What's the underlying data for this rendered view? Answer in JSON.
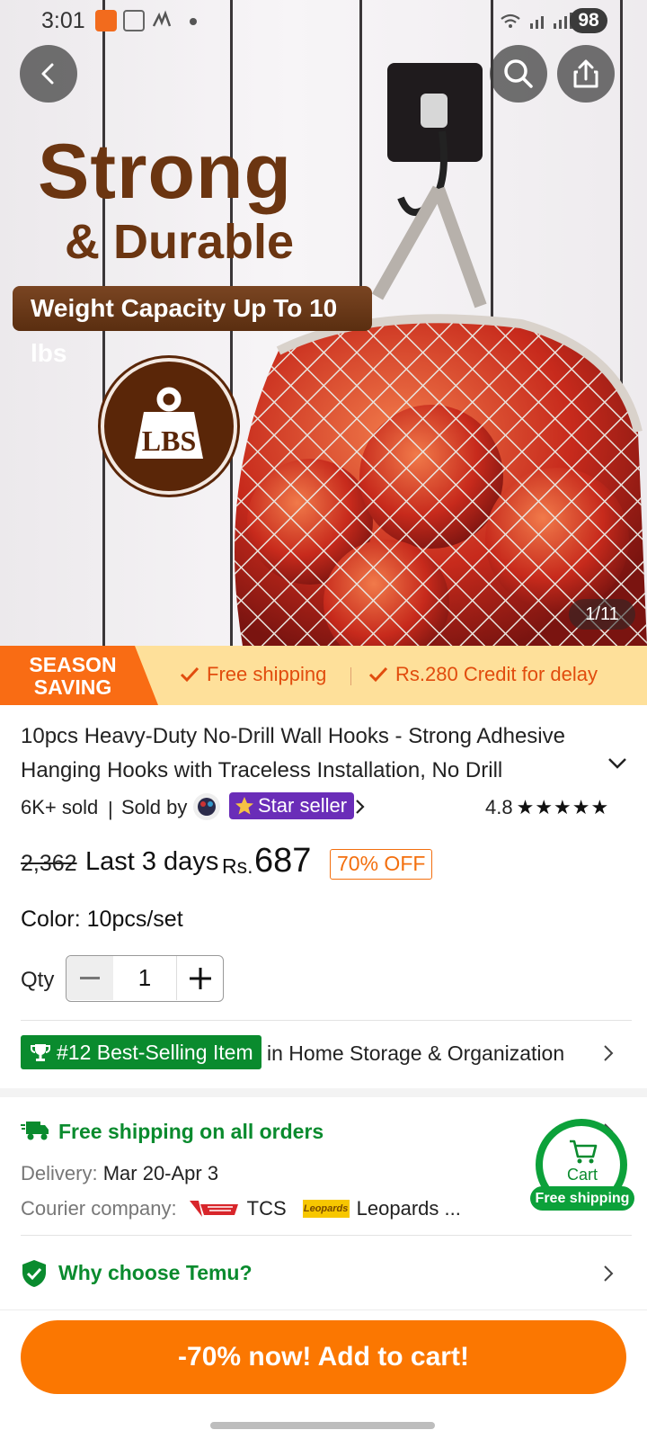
{
  "status_bar": {
    "time": "3:01",
    "battery": "98"
  },
  "hero": {
    "headline": "Strong",
    "subheadline": "& Durable",
    "ribbon": "Weight Capacity Up To 10 lbs",
    "badge": "LBS",
    "photo_counter": "1/11"
  },
  "promo": {
    "season_line1": "SEASON",
    "season_line2": "SAVING",
    "free_shipping": "Free shipping",
    "credit": "Rs.280 Credit for delay"
  },
  "product": {
    "title": "10pcs Heavy-Duty No-Drill Wall Hooks - Strong Adhesive Hanging Hooks with Traceless Installation, No Drill",
    "sold": "6K+ sold",
    "sold_by": "Sold by",
    "star_seller": "Star seller",
    "rating": "4.8",
    "rating_value": 4.8,
    "old_price": "2,362",
    "deal_label": "Last 3 days",
    "currency": "Rs.",
    "price": "687",
    "discount": "70% OFF",
    "color_label": "Color: 10pcs/set",
    "qty_label": "Qty",
    "qty_value": "1"
  },
  "best_selling": {
    "badge": "#12 Best-Selling Item",
    "category": "in Home Storage & Organization"
  },
  "shipping": {
    "title": "Free shipping on all orders",
    "delivery_label": "Delivery:",
    "delivery_value": "Mar 20-Apr 3",
    "courier_label": "Courier company:",
    "courier_1": "TCS",
    "courier_2": "Leopards ..."
  },
  "cart_float": {
    "label": "Cart",
    "badge": "Free shipping"
  },
  "why": {
    "title": "Why choose Temu?"
  },
  "cta": {
    "label": "-70% now! Add to cart!"
  },
  "colors": {
    "brand_orange": "#fb7701",
    "green": "#0a8b2e",
    "promo_bg": "#fee09a",
    "star_seller_purple": "#6a2db8"
  }
}
